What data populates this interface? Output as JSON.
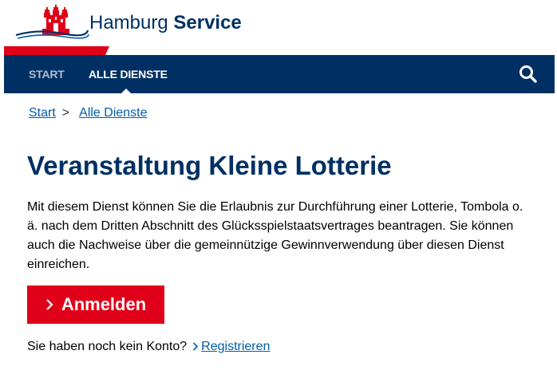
{
  "header": {
    "brand_part1": "Hamburg ",
    "brand_part2": "Service",
    "logo_icon": "hamburg-castle-logo-icon",
    "brand_color": "#003063",
    "accent_red": "#e10019"
  },
  "nav": {
    "items": [
      {
        "label": "START",
        "active": false
      },
      {
        "label": "ALLE DIENSTE",
        "active": true
      }
    ],
    "search_icon": "search-icon"
  },
  "breadcrumb": {
    "items": [
      "Start",
      "Alle Dienste"
    ],
    "separator": ">"
  },
  "main": {
    "title": "Veranstaltung Kleine Lotterie",
    "description": "Mit diesem Dienst können Sie die Erlaubnis zur Durchführung einer Lotterie, Tombola o. ä. nach dem Dritten Abschnitt des Glücksspielstaatsvertrages beantragen. Sie können auch die Nachweise über die gemeinnützige Gewinnverwendung über diesen Dienst einreichen.",
    "login_label": "Anmelden",
    "register_question": "Sie haben noch kein Konto?",
    "register_link": "Registrieren"
  }
}
